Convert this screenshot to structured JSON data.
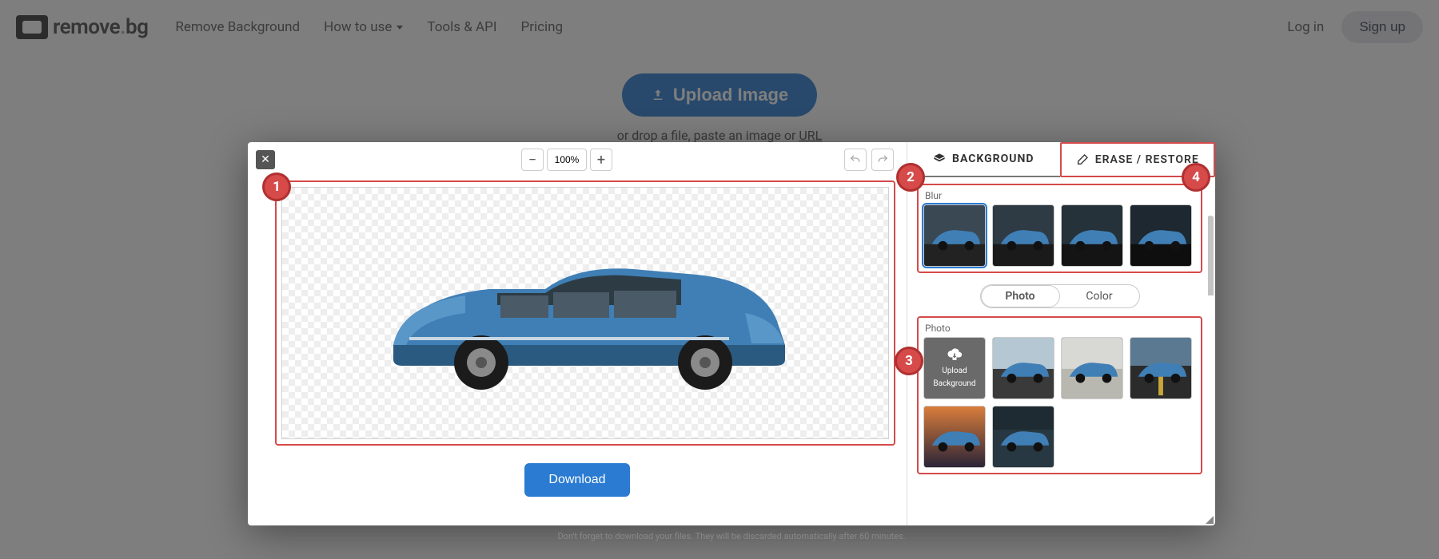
{
  "brand": {
    "name": "remove",
    "suffix": "bg"
  },
  "nav": {
    "remove_bg": "Remove Background",
    "how_to_use": "How to use",
    "tools_api": "Tools & API",
    "pricing": "Pricing",
    "login": "Log in",
    "signup": "Sign up"
  },
  "hero": {
    "upload_button": "Upload Image",
    "drop_prefix": "or drop a file, paste an image or ",
    "drop_url": "URL"
  },
  "editor": {
    "zoom_value": "100%",
    "download": "Download",
    "tabs": {
      "background": "BACKGROUND",
      "erase": "ERASE / RESTORE"
    },
    "blur_label": "Blur",
    "segment": {
      "photo": "Photo",
      "color": "Color"
    },
    "photo_label": "Photo",
    "upload_bg_line1": "Upload",
    "upload_bg_line2": "Background",
    "footer_note": "Don't forget to download your files. They will be discarded automatically after 60 minutes."
  },
  "markers": {
    "m1": "1",
    "m2": "2",
    "m3": "3",
    "m4": "4"
  }
}
